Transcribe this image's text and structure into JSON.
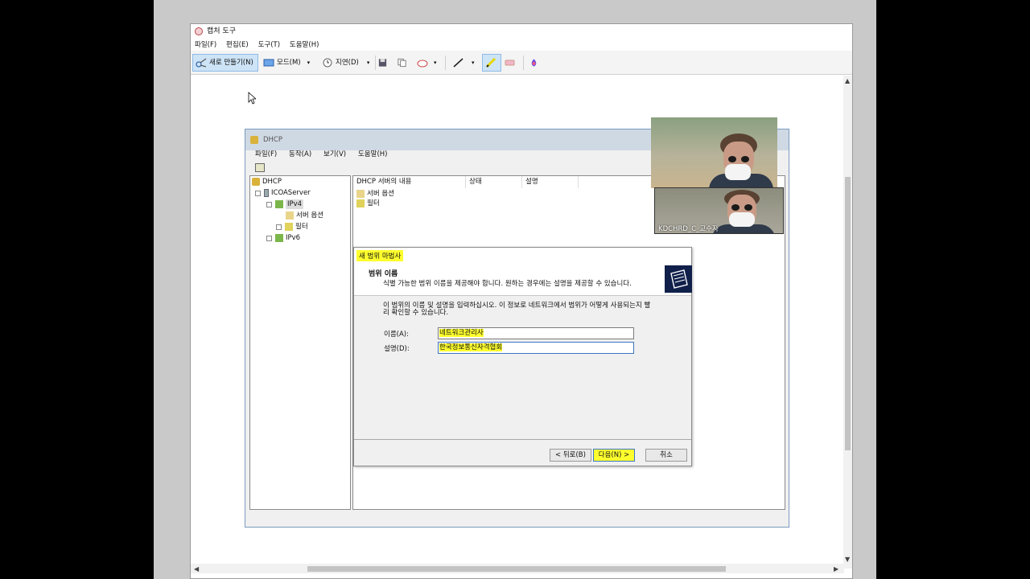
{
  "snip": {
    "title": "캡처 도구",
    "menu": [
      "파일(F)",
      "편집(E)",
      "도구(T)",
      "도움말(H)"
    ],
    "toolbar": {
      "new_label": "새로 만들기(N)",
      "mode_label": "모드(M)",
      "delay_label": "지연(D)"
    }
  },
  "dhcp": {
    "title": "DHCP",
    "menu": [
      "파일(F)",
      "동작(A)",
      "보기(V)",
      "도움말(H)"
    ],
    "tree": {
      "root": "DHCP",
      "server": "ICOAServer",
      "ipv4": "IPv4",
      "server_options": "서버 옵션",
      "filters": "필터",
      "ipv6": "IPv6"
    },
    "list": {
      "columns": [
        "DHCP 서버의 내용",
        "상태",
        "설명"
      ],
      "rows": [
        "서버 옵션",
        "필터"
      ]
    }
  },
  "wizard": {
    "title": "새 범위 마법사",
    "heading": "범위 이름",
    "subheading": "식별 가능한 범위 이름을 제공해야 합니다. 원하는 경우에는 설명을 제공할 수 있습니다.",
    "instructions": "이 범위의 이름 및 설명을 입력하십시오. 이 정보로 네트워크에서 범위가 어떻게 사용되는지 빨리 확인할 수 있습니다.",
    "name_label": "이름(A):",
    "name_value": "네트워크관리사",
    "desc_label": "설명(D):",
    "desc_value": "한국정보통신자격협회",
    "back_button": "< 뒤로(B)",
    "next_button": "다음(N) >",
    "cancel_button": "취소"
  },
  "webcam": {
    "name": "KDCHRD_C_교수자"
  }
}
